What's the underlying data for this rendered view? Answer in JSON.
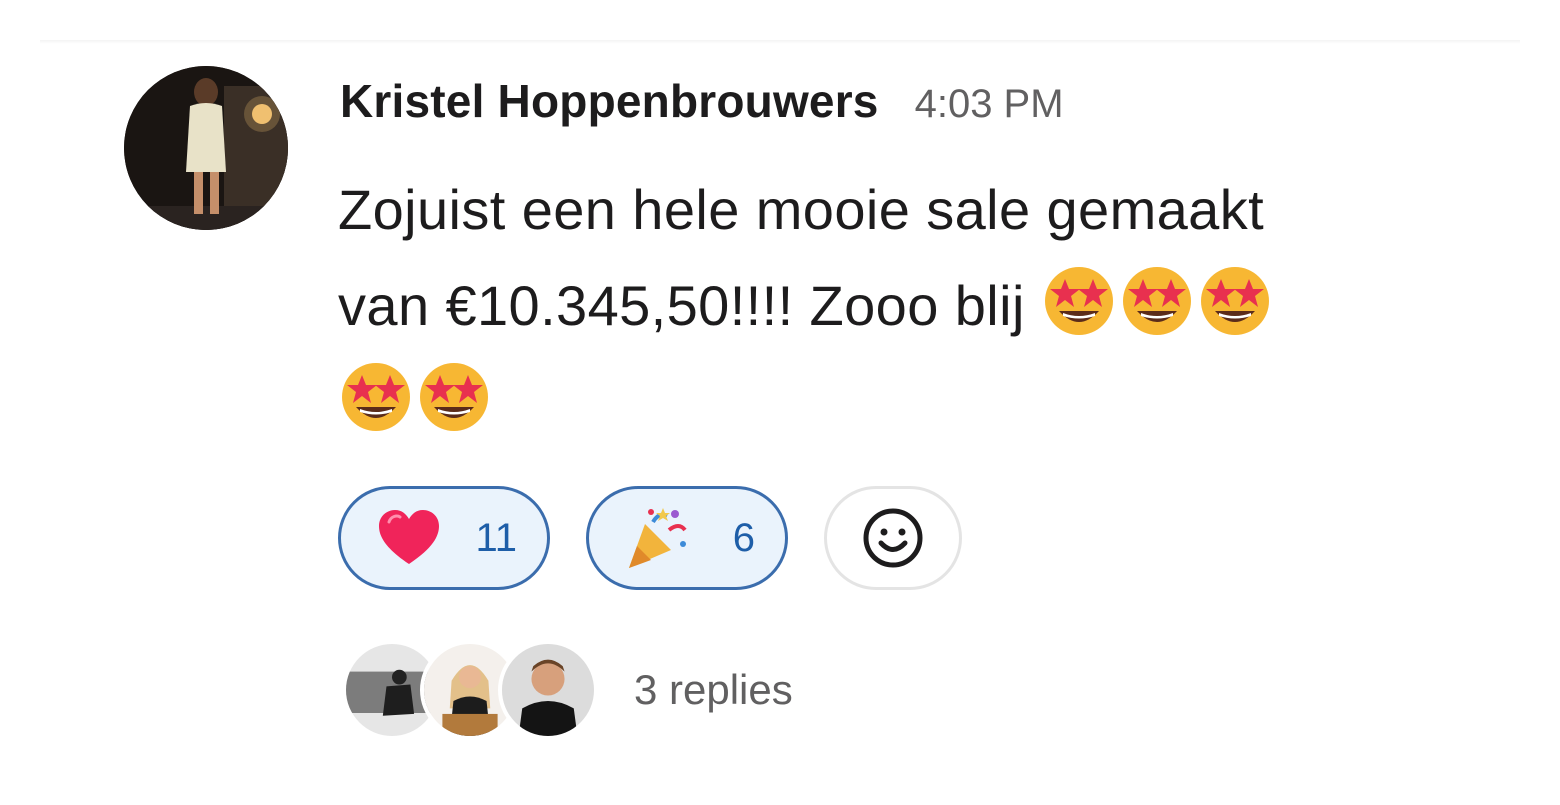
{
  "message": {
    "author": "Kristel Hoppenbrouwers",
    "timestamp": "4:03 PM",
    "text_line1": "Zojuist een hele mooie sale gemaakt",
    "text_line2": "van €10.345,50!!!! Zooo blij",
    "emojis": [
      "star-struck-emoji",
      "star-struck-emoji",
      "star-struck-emoji",
      "star-struck-emoji",
      "star-struck-emoji"
    ]
  },
  "reactions": [
    {
      "emoji": "red-heart-emoji",
      "count": "11"
    },
    {
      "emoji": "party-popper-emoji",
      "count": "6"
    }
  ],
  "add_reaction_icon": "smiley-add-reaction-icon",
  "thread": {
    "repliers": [
      "replier-avatar-1",
      "replier-avatar-2",
      "replier-avatar-3"
    ],
    "replies_label": "3 replies"
  },
  "colors": {
    "reaction_border": "#3b6dad",
    "reaction_bg": "#eaf3fc",
    "reaction_count": "#1e5ea8",
    "text": "#1d1c1d",
    "muted": "#616061"
  }
}
